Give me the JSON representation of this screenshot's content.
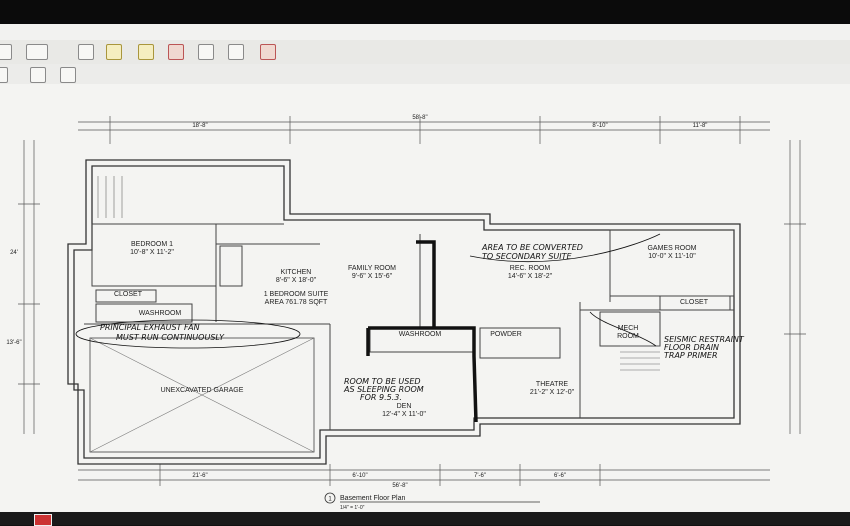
{
  "plan": {
    "rooms": {
      "bedroom_name": "BEDROOM 1",
      "bedroom_dims": "10'-8\" X 11'-2\"",
      "kitchen_name": "KITCHEN",
      "kitchen_dims": "8'-6\" X 18'-0\"",
      "family_name": "FAMILY ROOM",
      "family_dims": "9'-6\" X 15'-6\"",
      "suite_name": "1 BEDROOM SUITE",
      "suite_area": "AREA 761.78 SQFT",
      "closet_left": "CLOSET",
      "closet_right": "CLOSET",
      "washroom_left": "WASHROOM",
      "washroom_mid": "WASHROOM",
      "powder": "POWDER",
      "rec_name": "REC. ROOM",
      "rec_dims": "14'-6\" X 18'-2\"",
      "games_name": "GAMES ROOM",
      "games_dims": "10'-0\" X 11'-10\"",
      "mech_name": "MECH",
      "mech_name2": "ROOM",
      "theatre_name": "THEATRE",
      "theatre_dims": "21'-2\" X 12'-0\"",
      "den_name": "DEN",
      "den_dims": "12'-4\" X 11'-0\"",
      "garage_name": "UNEXCAVATED GARAGE"
    },
    "notes": {
      "note_ne": "AREA TO BE CONVERTED",
      "note_ne2": "TO SECONDARY SUITE",
      "note_garage": "PRINCIPAL EXHAUST FAN",
      "note_garage2": "MUST RUN CONTINUOUSLY",
      "note_den": "ROOM TO BE USED",
      "note_den2": "AS SLEEPING ROOM",
      "note_den3": "FOR 9.5.3.",
      "note_theatre": "SEISMIC RESTRAINT",
      "note_theatre2": "FLOOR DRAIN",
      "note_theatre3": "TRAP PRIMER"
    },
    "dims": {
      "bottom1": "21'-6\"",
      "bottom2": "6'-10\"",
      "bottom3": "56'-8\"",
      "bottom4": "7'-6\"",
      "bottom5": "6'-6\"",
      "top1": "18'-8\"",
      "top2": "58'-8\"",
      "top3": "8'-10\"",
      "top4": "11'-8\"",
      "left1": "24'",
      "left2": "13'-6\""
    },
    "title_num": "1",
    "title": "Basement Floor Plan",
    "scale": "1/4\" = 1'-0\""
  }
}
